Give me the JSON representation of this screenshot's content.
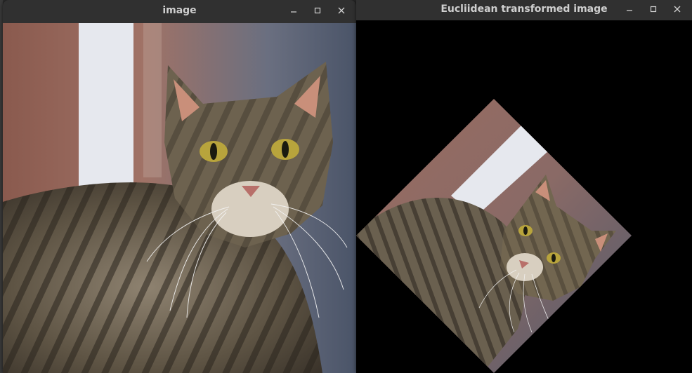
{
  "windows": [
    {
      "title": "image",
      "controls": {
        "minimize_icon": "minimize-icon",
        "maximize_icon": "maximize-icon",
        "close_icon": "close-icon"
      },
      "content": "original-cat-photo"
    },
    {
      "title": "Eucliidean transformed image",
      "controls": {
        "minimize_icon": "minimize-icon",
        "maximize_icon": "maximize-icon",
        "close_icon": "close-icon"
      },
      "content": "rotated-cat-photo"
    }
  ],
  "colors": {
    "titlebar_bg": "#303030",
    "title_text": "#cfcfcf",
    "canvas_black": "#000000"
  }
}
